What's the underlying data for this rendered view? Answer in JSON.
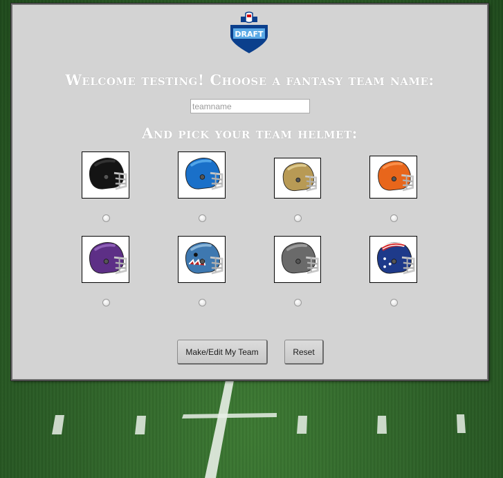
{
  "logo": {
    "text": "DRAFT",
    "icon": "nfl-draft-logo"
  },
  "welcome_heading": "Welcome testing! Choose a fantasy team name:",
  "team_name": {
    "value": "",
    "placeholder": "teamname"
  },
  "helmet_heading": "And pick your team helmet:",
  "helmets": [
    {
      "name": "black",
      "shell": "#141414",
      "accent": "#3a3a3a",
      "selected": false
    },
    {
      "name": "blue",
      "shell": "#1a70c9",
      "accent": "#5fb3f0",
      "selected": false
    },
    {
      "name": "gold",
      "shell": "#b89a55",
      "accent": "#e6d59a",
      "selected": false
    },
    {
      "name": "orange",
      "shell": "#e8661b",
      "accent": "#ff9a55",
      "selected": false
    },
    {
      "name": "purple",
      "shell": "#5d2f86",
      "accent": "#9b6cc4",
      "selected": false
    },
    {
      "name": "shark",
      "shell": "#3e78b0",
      "accent": "#9cc4e4",
      "selected": false
    },
    {
      "name": "gray",
      "shell": "#6a6a6a",
      "accent": "#a8a8a8",
      "selected": false
    },
    {
      "name": "stars-stripes",
      "shell": "#1e3a8a",
      "accent": "#d62828",
      "selected": false
    }
  ],
  "buttons": {
    "make_team": "Make/Edit My Team",
    "reset": "Reset"
  },
  "colors": {
    "panel_bg": "#d3d3d3",
    "heading_text": "#ffffff",
    "field": "#2f6228"
  }
}
